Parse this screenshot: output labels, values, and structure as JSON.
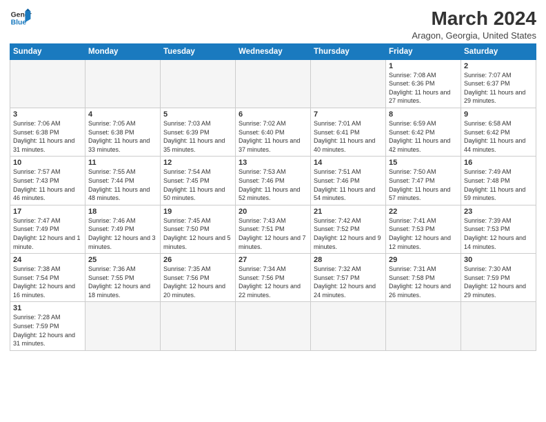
{
  "header": {
    "logo_general": "General",
    "logo_blue": "Blue",
    "month_year": "March 2024",
    "location": "Aragon, Georgia, United States"
  },
  "weekdays": [
    "Sunday",
    "Monday",
    "Tuesday",
    "Wednesday",
    "Thursday",
    "Friday",
    "Saturday"
  ],
  "weeks": [
    [
      {
        "day": "",
        "info": "",
        "empty": true
      },
      {
        "day": "",
        "info": "",
        "empty": true
      },
      {
        "day": "",
        "info": "",
        "empty": true
      },
      {
        "day": "",
        "info": "",
        "empty": true
      },
      {
        "day": "",
        "info": "",
        "empty": true
      },
      {
        "day": "1",
        "info": "Sunrise: 7:08 AM\nSunset: 6:36 PM\nDaylight: 11 hours\nand 27 minutes."
      },
      {
        "day": "2",
        "info": "Sunrise: 7:07 AM\nSunset: 6:37 PM\nDaylight: 11 hours\nand 29 minutes."
      }
    ],
    [
      {
        "day": "3",
        "info": "Sunrise: 7:06 AM\nSunset: 6:38 PM\nDaylight: 11 hours\nand 31 minutes."
      },
      {
        "day": "4",
        "info": "Sunrise: 7:05 AM\nSunset: 6:38 PM\nDaylight: 11 hours\nand 33 minutes."
      },
      {
        "day": "5",
        "info": "Sunrise: 7:03 AM\nSunset: 6:39 PM\nDaylight: 11 hours\nand 35 minutes."
      },
      {
        "day": "6",
        "info": "Sunrise: 7:02 AM\nSunset: 6:40 PM\nDaylight: 11 hours\nand 37 minutes."
      },
      {
        "day": "7",
        "info": "Sunrise: 7:01 AM\nSunset: 6:41 PM\nDaylight: 11 hours\nand 40 minutes."
      },
      {
        "day": "8",
        "info": "Sunrise: 6:59 AM\nSunset: 6:42 PM\nDaylight: 11 hours\nand 42 minutes."
      },
      {
        "day": "9",
        "info": "Sunrise: 6:58 AM\nSunset: 6:42 PM\nDaylight: 11 hours\nand 44 minutes."
      }
    ],
    [
      {
        "day": "10",
        "info": "Sunrise: 7:57 AM\nSunset: 7:43 PM\nDaylight: 11 hours\nand 46 minutes."
      },
      {
        "day": "11",
        "info": "Sunrise: 7:55 AM\nSunset: 7:44 PM\nDaylight: 11 hours\nand 48 minutes."
      },
      {
        "day": "12",
        "info": "Sunrise: 7:54 AM\nSunset: 7:45 PM\nDaylight: 11 hours\nand 50 minutes."
      },
      {
        "day": "13",
        "info": "Sunrise: 7:53 AM\nSunset: 7:46 PM\nDaylight: 11 hours\nand 52 minutes."
      },
      {
        "day": "14",
        "info": "Sunrise: 7:51 AM\nSunset: 7:46 PM\nDaylight: 11 hours\nand 54 minutes."
      },
      {
        "day": "15",
        "info": "Sunrise: 7:50 AM\nSunset: 7:47 PM\nDaylight: 11 hours\nand 57 minutes."
      },
      {
        "day": "16",
        "info": "Sunrise: 7:49 AM\nSunset: 7:48 PM\nDaylight: 11 hours\nand 59 minutes."
      }
    ],
    [
      {
        "day": "17",
        "info": "Sunrise: 7:47 AM\nSunset: 7:49 PM\nDaylight: 12 hours\nand 1 minute."
      },
      {
        "day": "18",
        "info": "Sunrise: 7:46 AM\nSunset: 7:49 PM\nDaylight: 12 hours\nand 3 minutes."
      },
      {
        "day": "19",
        "info": "Sunrise: 7:45 AM\nSunset: 7:50 PM\nDaylight: 12 hours\nand 5 minutes."
      },
      {
        "day": "20",
        "info": "Sunrise: 7:43 AM\nSunset: 7:51 PM\nDaylight: 12 hours\nand 7 minutes."
      },
      {
        "day": "21",
        "info": "Sunrise: 7:42 AM\nSunset: 7:52 PM\nDaylight: 12 hours\nand 9 minutes."
      },
      {
        "day": "22",
        "info": "Sunrise: 7:41 AM\nSunset: 7:53 PM\nDaylight: 12 hours\nand 12 minutes."
      },
      {
        "day": "23",
        "info": "Sunrise: 7:39 AM\nSunset: 7:53 PM\nDaylight: 12 hours\nand 14 minutes."
      }
    ],
    [
      {
        "day": "24",
        "info": "Sunrise: 7:38 AM\nSunset: 7:54 PM\nDaylight: 12 hours\nand 16 minutes."
      },
      {
        "day": "25",
        "info": "Sunrise: 7:36 AM\nSunset: 7:55 PM\nDaylight: 12 hours\nand 18 minutes."
      },
      {
        "day": "26",
        "info": "Sunrise: 7:35 AM\nSunset: 7:56 PM\nDaylight: 12 hours\nand 20 minutes."
      },
      {
        "day": "27",
        "info": "Sunrise: 7:34 AM\nSunset: 7:56 PM\nDaylight: 12 hours\nand 22 minutes."
      },
      {
        "day": "28",
        "info": "Sunrise: 7:32 AM\nSunset: 7:57 PM\nDaylight: 12 hours\nand 24 minutes."
      },
      {
        "day": "29",
        "info": "Sunrise: 7:31 AM\nSunset: 7:58 PM\nDaylight: 12 hours\nand 26 minutes."
      },
      {
        "day": "30",
        "info": "Sunrise: 7:30 AM\nSunset: 7:59 PM\nDaylight: 12 hours\nand 29 minutes."
      }
    ],
    [
      {
        "day": "31",
        "info": "Sunrise: 7:28 AM\nSunset: 7:59 PM\nDaylight: 12 hours\nand 31 minutes."
      },
      {
        "day": "",
        "info": "",
        "empty": true
      },
      {
        "day": "",
        "info": "",
        "empty": true
      },
      {
        "day": "",
        "info": "",
        "empty": true
      },
      {
        "day": "",
        "info": "",
        "empty": true
      },
      {
        "day": "",
        "info": "",
        "empty": true
      },
      {
        "day": "",
        "info": "",
        "empty": true
      }
    ]
  ]
}
